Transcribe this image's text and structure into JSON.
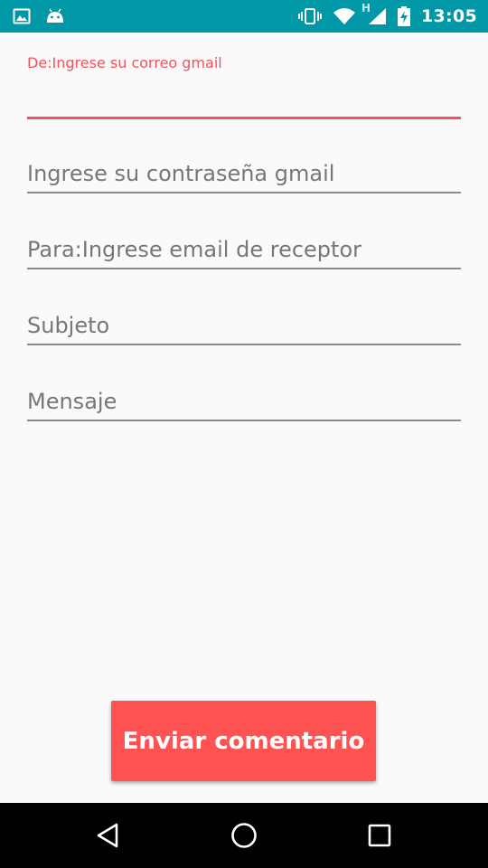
{
  "status_bar": {
    "time": "13:05",
    "network_type": "H",
    "left_icons": [
      "image-icon",
      "android-icon"
    ],
    "right_icons": [
      "vibrate-icon",
      "wifi-icon",
      "signal-icon",
      "battery-charging-icon"
    ]
  },
  "form": {
    "fields": [
      {
        "label": "De:Ingrese su correo gmail",
        "placeholder": "",
        "value": "",
        "focused": true
      },
      {
        "label": "",
        "placeholder": "Ingrese su contraseña gmail",
        "value": ""
      },
      {
        "label": "",
        "placeholder": "Para:Ingrese email de receptor",
        "value": ""
      },
      {
        "label": "",
        "placeholder": "Subjeto",
        "value": ""
      },
      {
        "label": "",
        "placeholder": "Mensaje",
        "value": ""
      }
    ]
  },
  "send_button": {
    "label": "Enviar comentario"
  },
  "nav_bar": {
    "icons": [
      "back-icon",
      "home-icon",
      "recents-icon"
    ]
  },
  "colors": {
    "status_bar": "#0097a7",
    "accent": "#f0545a",
    "button": "#ff5252",
    "background": "#fafafa",
    "nav_bar": "#000000"
  }
}
